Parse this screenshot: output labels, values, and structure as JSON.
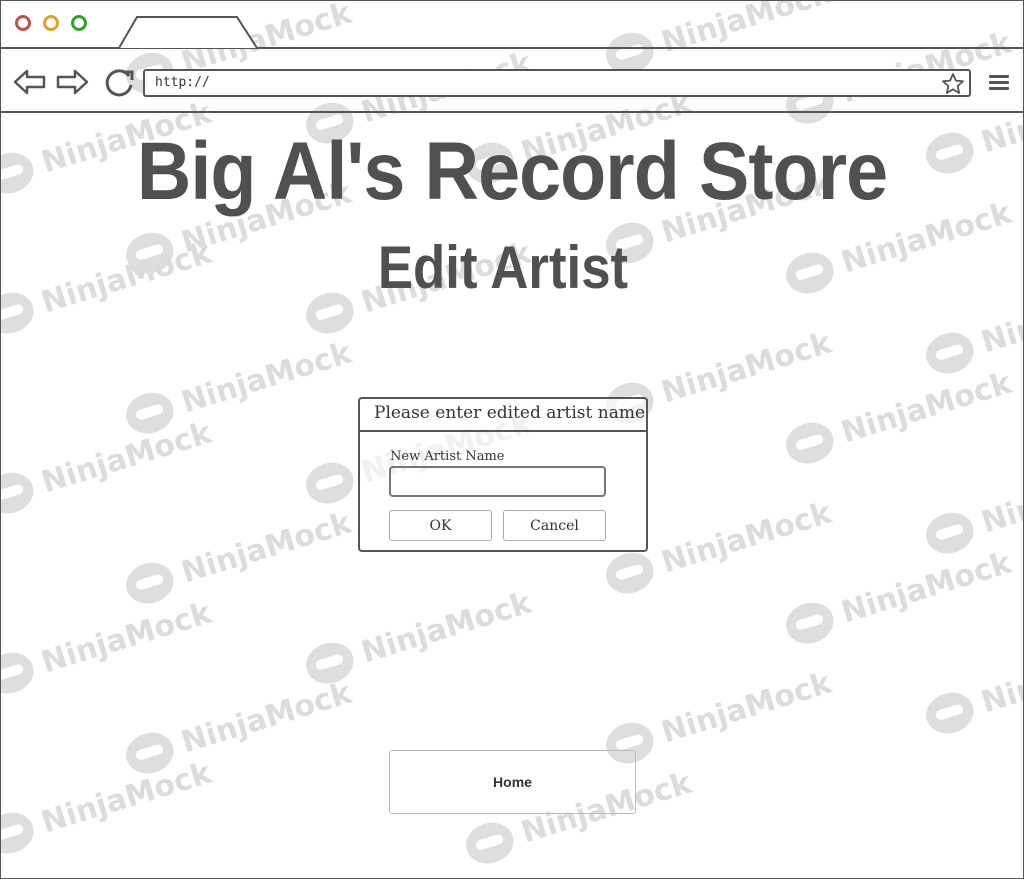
{
  "browser": {
    "url": "http://",
    "icons": [
      "back-arrow-icon",
      "forward-arrow-icon",
      "reload-icon",
      "star-icon",
      "hamburger-menu-icon"
    ],
    "traffic_lights": {
      "close": "#c0504d",
      "minimize": "#e0a030",
      "maximize": "#2ea030"
    }
  },
  "page": {
    "title": "Big Al's Record Store",
    "subtitle": "Edit Artist"
  },
  "dialog": {
    "header": "Please enter edited artist name",
    "field_label": "New Artist Name",
    "field_value": "",
    "ok_label": "OK",
    "cancel_label": "Cancel"
  },
  "footer": {
    "home_label": "Home"
  },
  "watermark": "NinjaMock"
}
